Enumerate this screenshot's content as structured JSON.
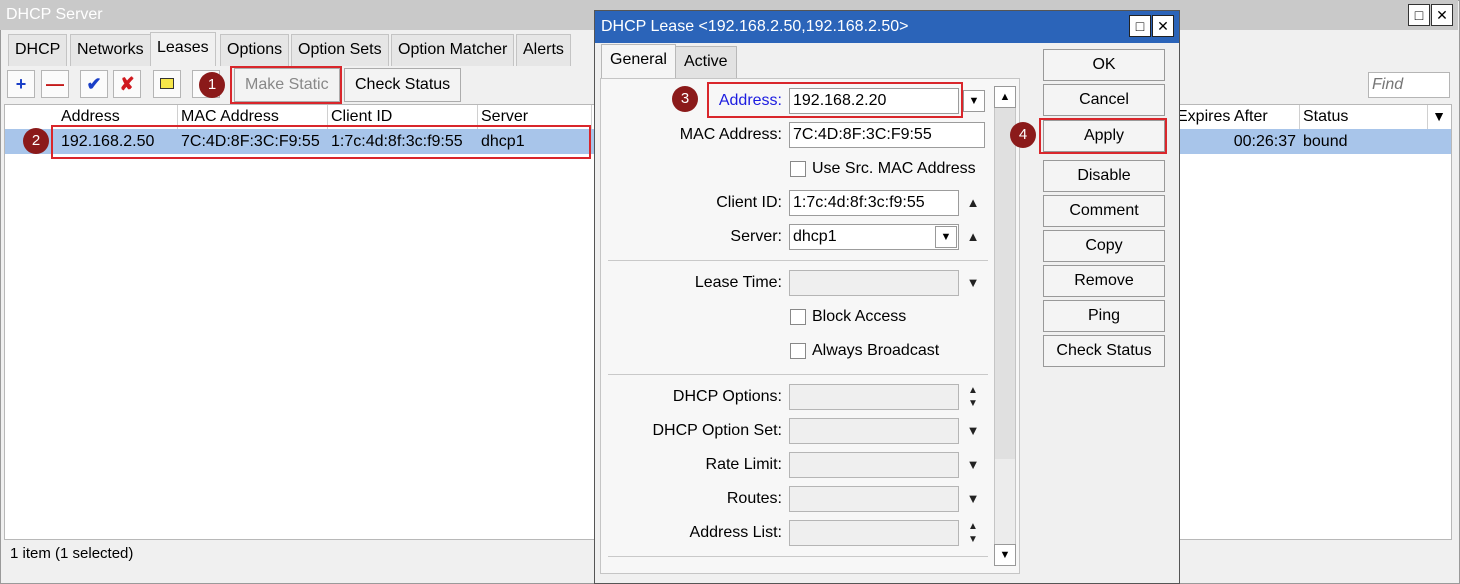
{
  "window": {
    "title": "DHCP Server"
  },
  "tabs": [
    "DHCP",
    "Networks",
    "Leases",
    "Options",
    "Option Sets",
    "Option Matcher",
    "Alerts"
  ],
  "toolbar": {
    "make_static_label": "Make Static",
    "check_status_label": "Check Status",
    "find_placeholder": "Find"
  },
  "table": {
    "columns": [
      "Address",
      "MAC Address",
      "Client ID",
      "Server",
      "Expires After",
      "Status"
    ],
    "rows": [
      {
        "address": "192.168.2.50",
        "mac": "7C:4D:8F:3C:F9:55",
        "client_id": "1:7c:4d:8f:3c:f9:55",
        "server": "dhcp1",
        "expires_after": "00:26:37",
        "status": "bound"
      }
    ]
  },
  "status_bar": "1 item (1 selected)",
  "badges": [
    "1",
    "2",
    "3",
    "4"
  ],
  "dialog": {
    "title": "DHCP Lease <192.168.2.50,192.168.2.50>",
    "tabs": [
      "General",
      "Active"
    ],
    "fields": {
      "address_label": "Address:",
      "address_value": "192.168.2.20",
      "mac_label": "MAC Address:",
      "mac_value": "7C:4D:8F:3C:F9:55",
      "use_src_mac_label": "Use Src. MAC Address",
      "client_id_label": "Client ID:",
      "client_id_value": "1:7c:4d:8f:3c:f9:55",
      "server_label": "Server:",
      "server_value": "dhcp1",
      "lease_time_label": "Lease Time:",
      "block_access_label": "Block Access",
      "always_broadcast_label": "Always Broadcast",
      "dhcp_options_label": "DHCP Options:",
      "dhcp_option_set_label": "DHCP Option Set:",
      "rate_limit_label": "Rate Limit:",
      "routes_label": "Routes:",
      "address_list_label": "Address List:"
    },
    "buttons": [
      "OK",
      "Cancel",
      "Apply",
      "Disable",
      "Comment",
      "Copy",
      "Remove",
      "Ping",
      "Check Status"
    ]
  },
  "colors": {
    "title_bar_active": "#2b64b9",
    "selection": "#a8c5ea",
    "highlight_red": "#d9262b",
    "badge": "#8b1a1a",
    "address_label_blue": "#1c1ce0"
  }
}
